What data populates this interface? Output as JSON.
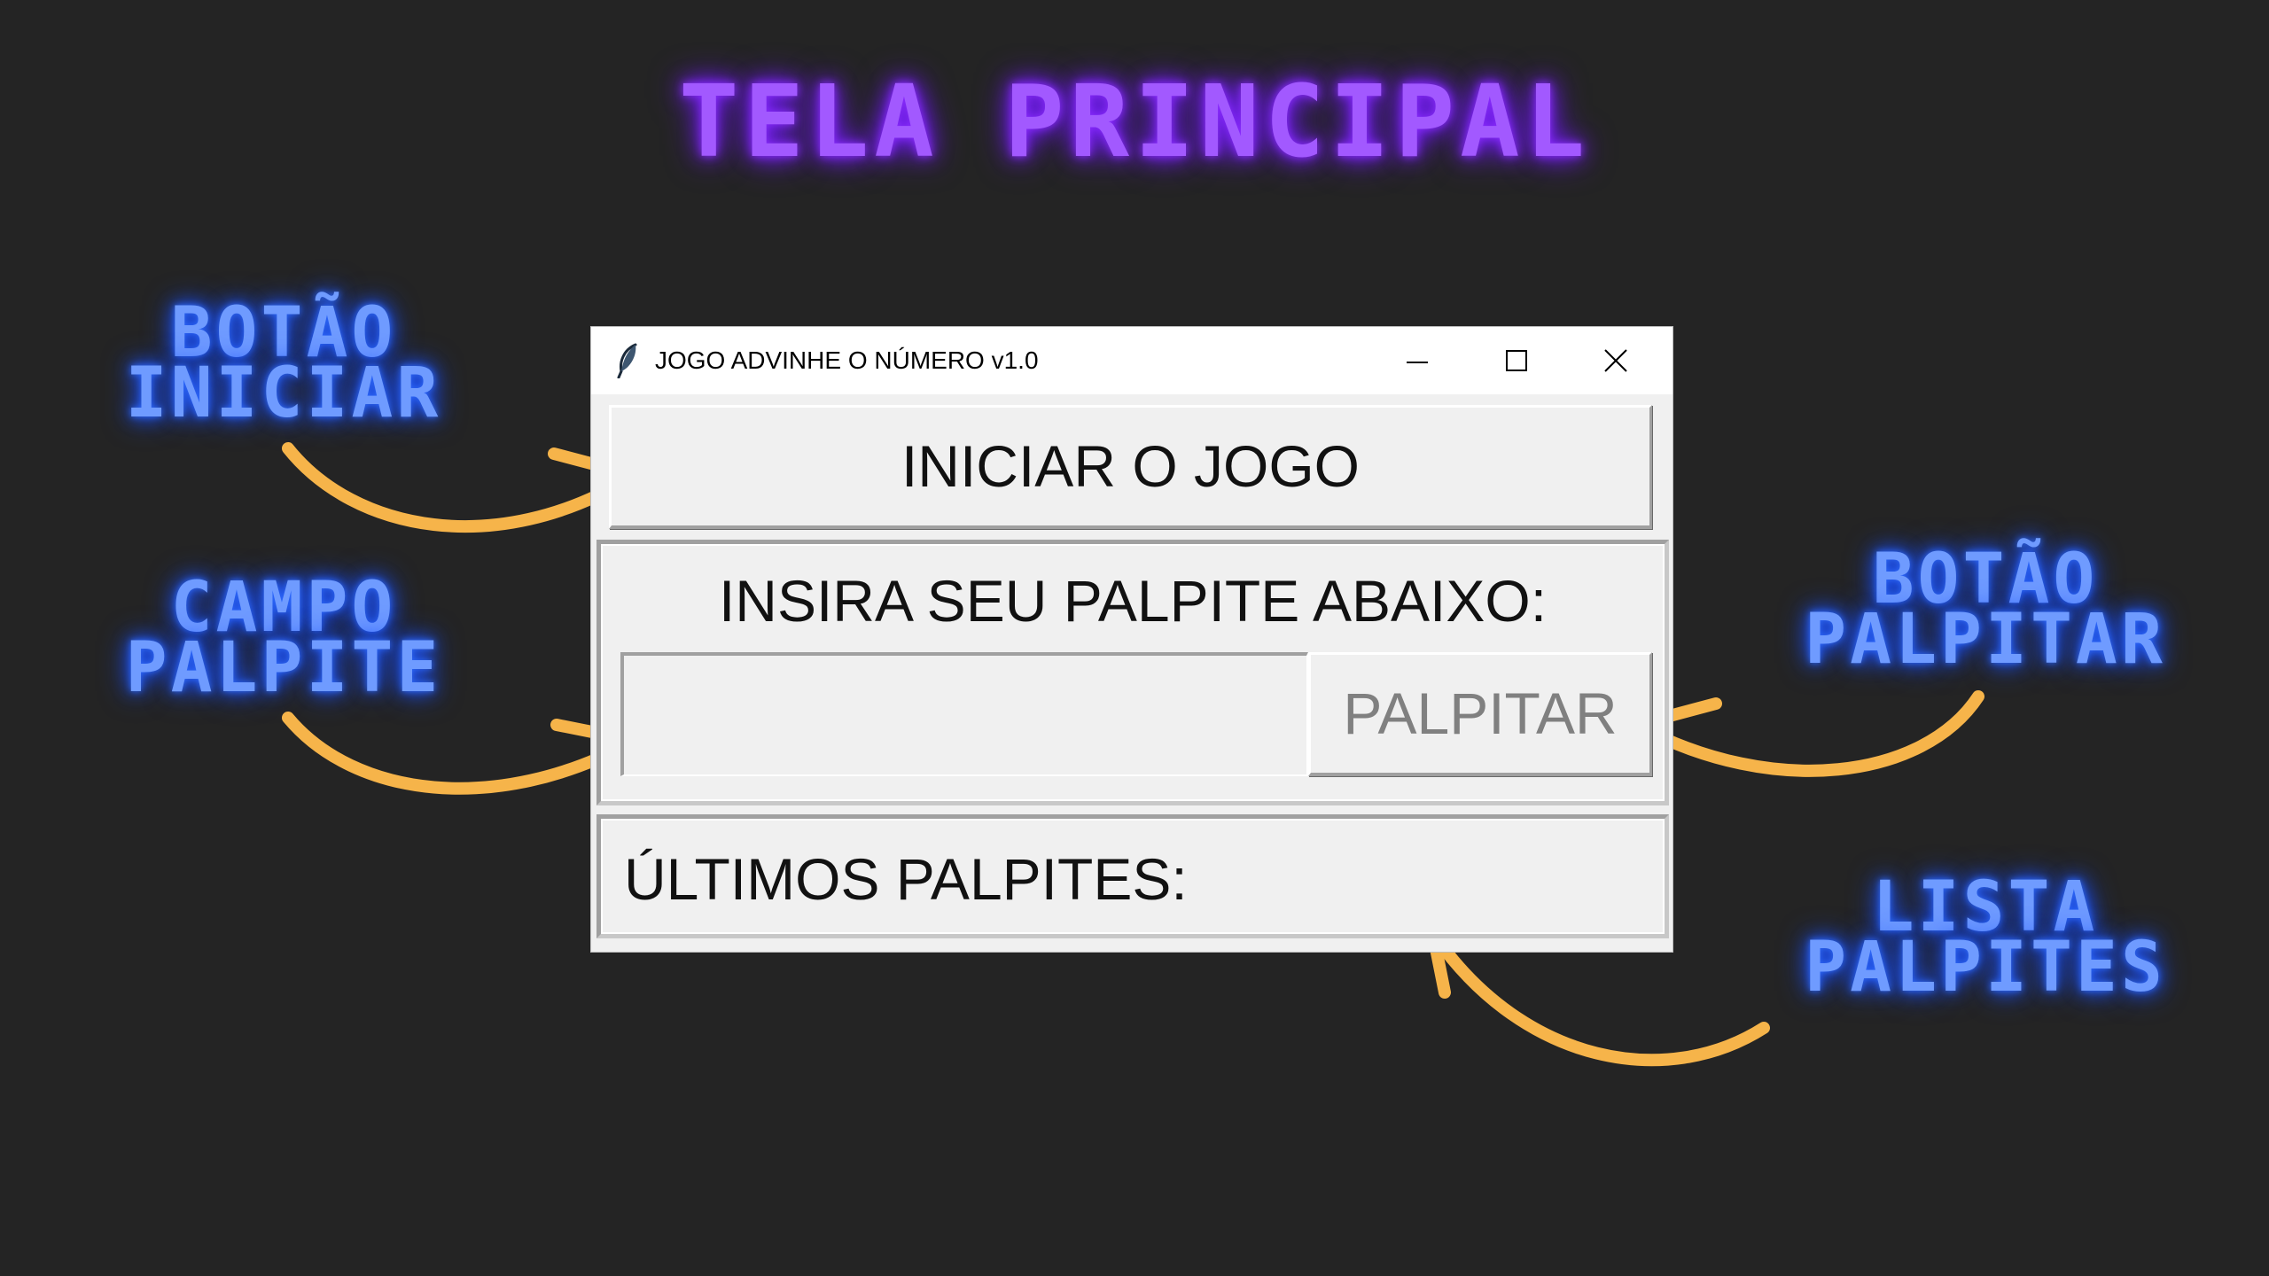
{
  "page": {
    "title": "TELA PRINCIPAL"
  },
  "annotations": {
    "start_button": [
      "BOTÃO",
      "INICIAR"
    ],
    "guess_field": [
      "CAMPO",
      "PALPITE"
    ],
    "guess_button": [
      "BOTÃO",
      "PALPITAR"
    ],
    "guess_list": [
      "LISTA",
      "PALPITES"
    ]
  },
  "window": {
    "title": "JOGO ADVINHE O NÚMERO v1.0",
    "icon": "feather-icon",
    "controls": [
      "minimize-icon",
      "maximize-icon",
      "close-icon"
    ]
  },
  "app": {
    "start_button_label": "INICIAR O JOGO",
    "guess_prompt": "INSIRA SEU PALPITE ABAIXO:",
    "guess_input_value": "",
    "guess_button_label": "PALPITAR",
    "guess_button_state": "disabled",
    "history_label": "ÚLTIMOS PALPITES:"
  },
  "colors": {
    "background": "#242424",
    "title_glow": "#a259ff",
    "annotation_glow": "#6f9bff",
    "arrow": "#f6b44a",
    "window_face": "#f0f0f0"
  }
}
